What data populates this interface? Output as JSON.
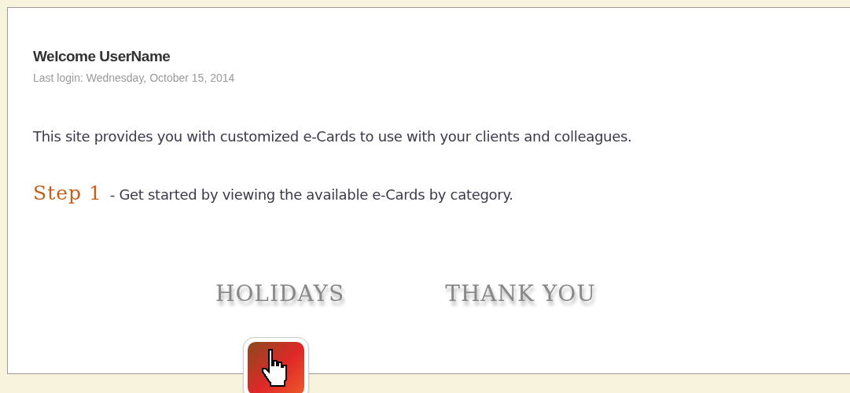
{
  "welcome": {
    "title": "Welcome UserName",
    "last_login": "Last login: Wednesday, October 15, 2014"
  },
  "intro": "This site provides you with customized e-Cards to use with your clients and colleagues.",
  "step": {
    "label": "Step 1",
    "text": "- Get started by viewing the available e-Cards by category."
  },
  "categories": [
    {
      "label": "HOLIDAYS"
    },
    {
      "label": "THANK YOU"
    }
  ]
}
